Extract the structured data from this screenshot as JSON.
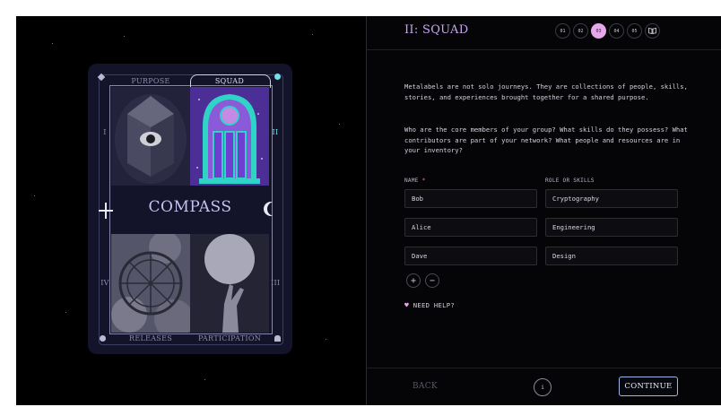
{
  "card": {
    "tabs": {
      "purpose": "PURPOSE",
      "squad": "SQUAD"
    },
    "title": "COMPASS",
    "bottom_labels": {
      "releases": "RELEASES",
      "participation": "PARTICIPATION"
    },
    "side_numerals": {
      "left_top": "I",
      "right_top": "II",
      "left_bottom": "IV",
      "right_bottom": "III"
    }
  },
  "header": {
    "title": "II: SQUAD",
    "steps": [
      {
        "label": "01",
        "active": false
      },
      {
        "label": "02",
        "active": false
      },
      {
        "label": "03",
        "active": true
      },
      {
        "label": "04",
        "active": false
      },
      {
        "label": "05",
        "active": false
      }
    ],
    "book_icon": "book-icon"
  },
  "intro": {
    "p1": "Metalabels are not solo journeys. They are collections of people, skills, stories, and experiences brought together for a shared purpose.",
    "p2": "Who are the core members of your group? What skills do they possess? What contributors are part of your network? What people and resources are in your inventory?"
  },
  "form": {
    "name_label": "NAME",
    "required_mark": "*",
    "role_label": "ROLE OR SKILLS",
    "rows": [
      {
        "name": "Bob",
        "role": "Cryptography"
      },
      {
        "name": "Alice",
        "role": "Engineering"
      },
      {
        "name": "Dave",
        "role": "Design"
      }
    ],
    "add_symbol": "+",
    "remove_symbol": "−"
  },
  "help": {
    "icon": "heart-icon",
    "label": "NEED HELP?"
  },
  "footer": {
    "back": "BACK",
    "info": "i",
    "continue": "CONTINUE"
  },
  "colors": {
    "accent": "#e5a8ea",
    "continue_border": "#9fb6ea",
    "title": "#c9a6ee"
  }
}
